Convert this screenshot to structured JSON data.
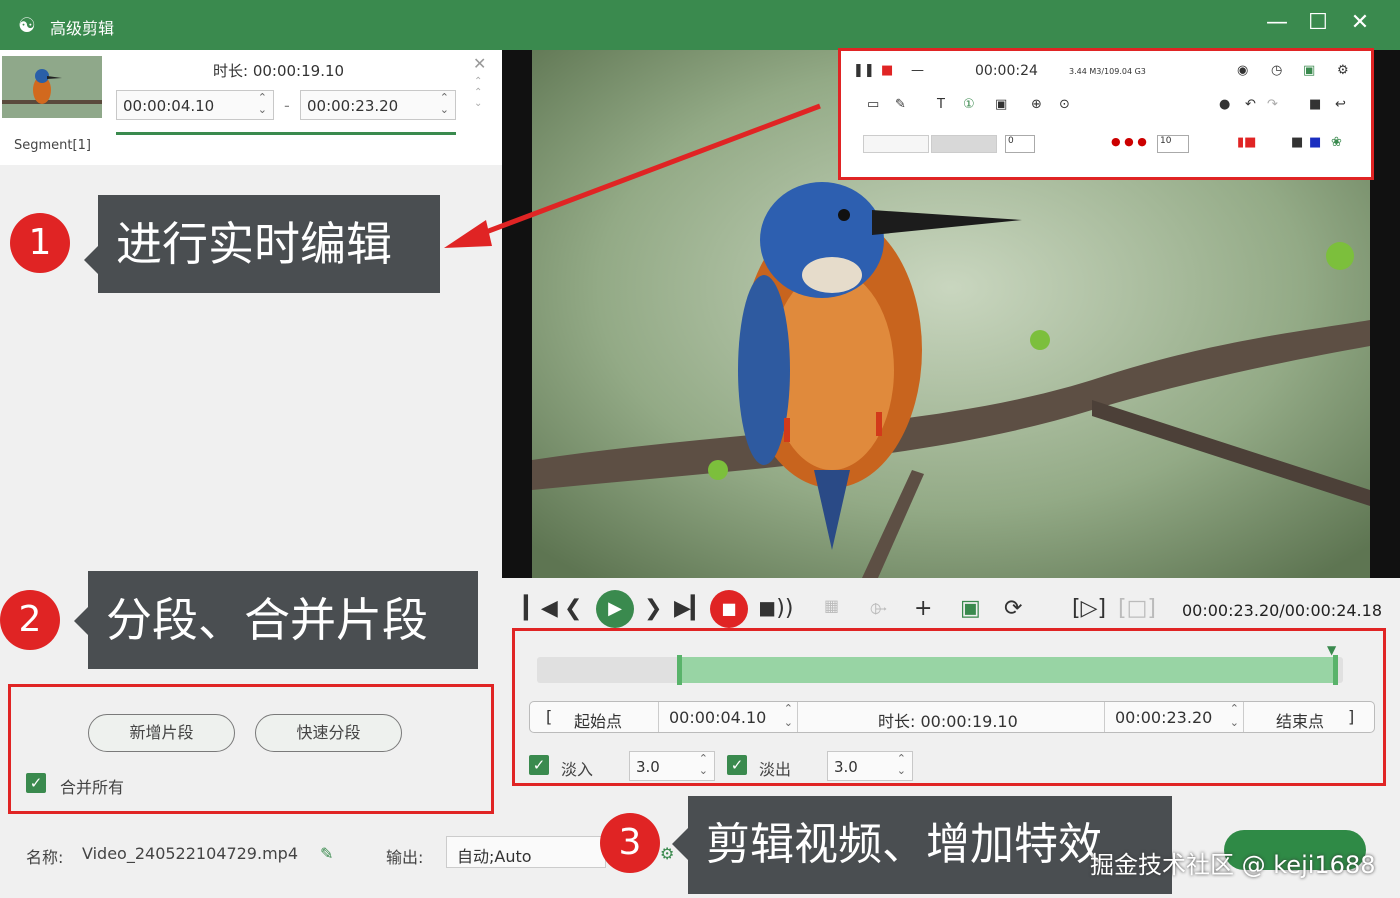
{
  "app": {
    "title": "高级剪辑"
  },
  "segment": {
    "label": "Segment[1]",
    "duration_label": "时长: 00:00:19.10",
    "start": "00:00:04.10",
    "end": "00:00:23.20"
  },
  "callouts": [
    {
      "num": "1",
      "text": "进行实时编辑"
    },
    {
      "num": "2",
      "text": "分段、合并片段"
    },
    {
      "num": "3",
      "text": "剪辑视频、增加特效"
    }
  ],
  "left_actions": {
    "new_segment": "新增片段",
    "quick_split": "快速分段",
    "merge_all": "合并所有"
  },
  "toolbar_panel": {
    "time": "00:00:24",
    "info": "3.44 M3/109.04 G3",
    "width_value": "10"
  },
  "playback": {
    "time_readout": "00:00:23.20/00:00:24.18"
  },
  "timeline": {
    "start_label": "起始点",
    "start_value": "00:00:04.10",
    "duration_label": "时长: 00:00:19.10",
    "end_value": "00:00:23.20",
    "end_label": "结束点",
    "fade_in_label": "淡入",
    "fade_in_value": "3.0",
    "fade_out_label": "淡出",
    "fade_out_value": "3.0"
  },
  "bottom": {
    "name_label": "名称:",
    "file_name": "Video_240522104729.mp4",
    "output_label": "输出:",
    "output_value": "自动;Auto"
  },
  "watermark": "掘金技术社区 @ keji1688",
  "colors": {
    "accent": "#3a8a4e",
    "callout_red": "#e02424",
    "callout_bg": "#4a4e51"
  }
}
